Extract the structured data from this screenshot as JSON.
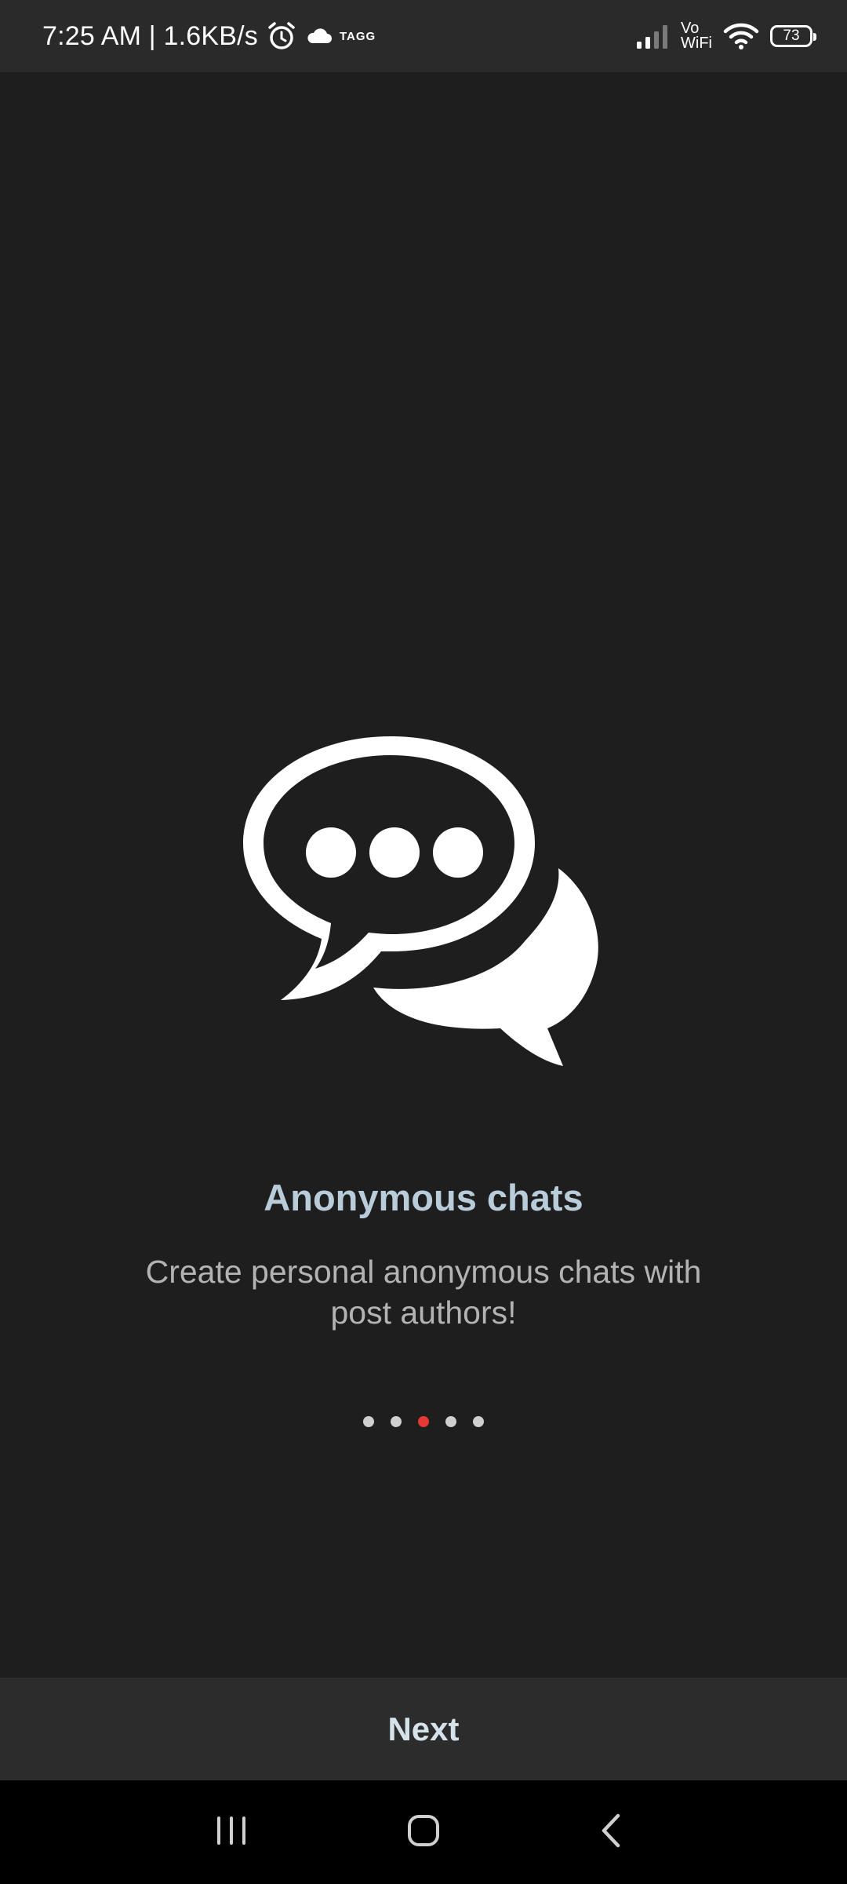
{
  "status_bar": {
    "time_speed": "7:25 AM | 1.6KB/s",
    "carrier_badge": "TAGG",
    "vowifi_top": "Vo",
    "vowifi_bottom": "WiFi",
    "battery_level": "73"
  },
  "onboarding": {
    "icon": "chat-bubbles-icon",
    "title": "Anonymous chats",
    "subtitle": "Create personal anonymous chats with post authors!",
    "page_indicator": {
      "total_pages": 5,
      "current_page": 3,
      "active_color": "#e53935",
      "inactive_color": "#cfcfcf"
    }
  },
  "footer": {
    "next_label": "Next"
  },
  "navigation_bar": {
    "recents_icon": "recents-icon",
    "home_icon": "home-icon",
    "back_icon": "back-icon"
  }
}
